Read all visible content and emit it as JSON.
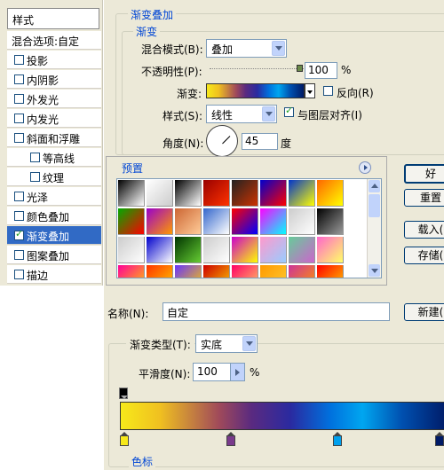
{
  "sidebar": {
    "title": "样式",
    "items": [
      {
        "label": "混合选项:自定",
        "checkbox": false,
        "checked": false,
        "indent": false,
        "selected": false
      },
      {
        "label": "投影",
        "checkbox": true,
        "checked": false,
        "indent": false,
        "selected": false
      },
      {
        "label": "内阴影",
        "checkbox": true,
        "checked": false,
        "indent": false,
        "selected": false
      },
      {
        "label": "外发光",
        "checkbox": true,
        "checked": false,
        "indent": false,
        "selected": false
      },
      {
        "label": "内发光",
        "checkbox": true,
        "checked": false,
        "indent": false,
        "selected": false
      },
      {
        "label": "斜面和浮雕",
        "checkbox": true,
        "checked": false,
        "indent": false,
        "selected": false
      },
      {
        "label": "等高线",
        "checkbox": true,
        "checked": false,
        "indent": true,
        "selected": false
      },
      {
        "label": "纹理",
        "checkbox": true,
        "checked": false,
        "indent": true,
        "selected": false
      },
      {
        "label": "光泽",
        "checkbox": true,
        "checked": false,
        "indent": false,
        "selected": false
      },
      {
        "label": "颜色叠加",
        "checkbox": true,
        "checked": false,
        "indent": false,
        "selected": false
      },
      {
        "label": "渐变叠加",
        "checkbox": true,
        "checked": true,
        "indent": false,
        "selected": true
      },
      {
        "label": "图案叠加",
        "checkbox": true,
        "checked": false,
        "indent": false,
        "selected": false
      },
      {
        "label": "描边",
        "checkbox": true,
        "checked": false,
        "indent": false,
        "selected": false
      }
    ]
  },
  "overlay": {
    "section_title": "渐变叠加",
    "group_title": "渐变",
    "blend_mode_label": "混合模式(B):",
    "blend_mode_value": "叠加",
    "opacity_label": "不透明性(P):",
    "opacity_value": "100",
    "opacity_unit": "%",
    "opacity_level": 1.0,
    "gradient_label": "渐变:",
    "reverse_label": "反向(R)",
    "reverse_checked": false,
    "style_label": "样式(S):",
    "style_value": "线性",
    "align_label": "与图层对齐(I)",
    "align_checked": true,
    "angle_label": "角度(N):",
    "angle_value": "45",
    "angle_unit": "度"
  },
  "presets": {
    "title": "预置",
    "menu_icon": "circle-arrow-icon",
    "swatch_colors": [
      [
        "#000000",
        "#ffffff"
      ],
      [
        "#ffffff",
        "#cccccc"
      ],
      [
        "#000000",
        "#ffffff"
      ],
      [
        "#990000",
        "#ff3300"
      ],
      [
        "#222222",
        "#cc3300"
      ],
      [
        "#0000cc",
        "#ff0000"
      ],
      [
        "#0033cc",
        "#ffff00"
      ],
      [
        "#ff6600",
        "#ffff00"
      ],
      [
        "#00aa00",
        "#ff0000"
      ],
      [
        "#9900cc",
        "#ff9900"
      ],
      [
        "#cc6633",
        "#ffcc99"
      ],
      [
        "#3366cc",
        "#ffffff"
      ],
      [
        "#ff0000",
        "#0000ff"
      ],
      [
        "#ff00ff",
        "#00ffff"
      ],
      [
        "#cccccc",
        "#ffffff"
      ],
      [
        "#000000",
        "#999999"
      ],
      [
        "#cccccc",
        "#ffffff"
      ],
      [
        "#0000cc",
        "#ffffff"
      ],
      [
        "#003300",
        "#66cc33"
      ],
      [
        "#cccccc",
        "#ffffff"
      ],
      [
        "#cc00cc",
        "#ffff00"
      ],
      [
        "#ff99cc",
        "#99ccff"
      ],
      [
        "#66cc99",
        "#cc66cc"
      ],
      [
        "#ff66cc",
        "#ffff66"
      ],
      [
        "#ff0099",
        "#ffcc00"
      ],
      [
        "#ff3300",
        "#ffcc00"
      ],
      [
        "#6633ff",
        "#ffcc00"
      ],
      [
        "#cc0000",
        "#ffcc00"
      ],
      [
        "#ff0066",
        "#ffcc66"
      ],
      [
        "#ff9900",
        "#ffcc33"
      ],
      [
        "#cc3399",
        "#ff9900"
      ],
      [
        "#ff0000",
        "#ffcc00"
      ]
    ]
  },
  "buttons": {
    "ok": "好",
    "reset": "重置",
    "load": "载入(",
    "save": "存储(",
    "new": "新建("
  },
  "name_row": {
    "label": "名称(N):",
    "value": "自定"
  },
  "gradient_type": {
    "label": "渐变类型(T):",
    "value": "实底",
    "smooth_label": "平滑度(N):",
    "smooth_value": "100",
    "smooth_unit": "%"
  },
  "color_stops": {
    "title": "色标",
    "colors": [
      "#f7e91a",
      "#7a3a8c",
      "#00a0ee",
      "#001a66"
    ]
  },
  "gradient_css": "linear-gradient(to right,#f7e91a 0%,#f0c020 12%,#a04a5a 30%,#5a2a80 40%,#2a2aa0 52%,#0070dd 64%,#00a6f0 74%,#0050b0 86%,#001a66 100%)"
}
